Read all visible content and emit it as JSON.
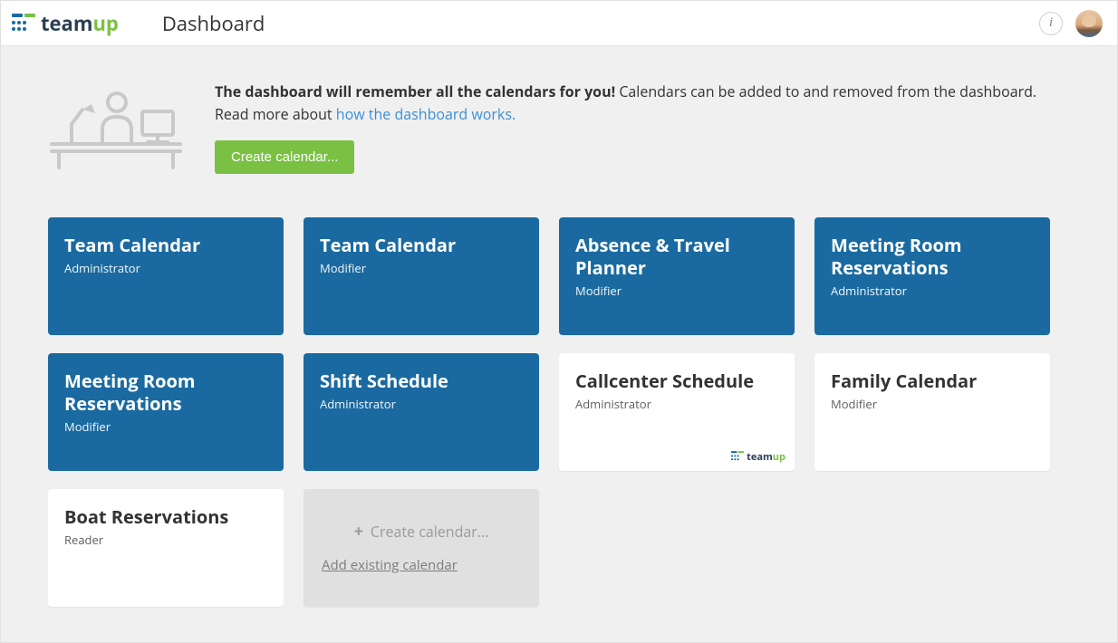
{
  "header": {
    "brand_team": "team",
    "brand_up": "up",
    "page_title": "Dashboard",
    "info_glyph": "i"
  },
  "intro": {
    "bold": "The dashboard will remember all the calendars for you!",
    "rest": " Calendars can be added to and removed from the dashboard. Read more about ",
    "link_text": "how the dashboard works.",
    "create_button": "Create calendar..."
  },
  "cards": [
    {
      "title": "Team Calendar",
      "role": "Administrator",
      "variant": "blue",
      "badge": false
    },
    {
      "title": "Team Calendar",
      "role": "Modifier",
      "variant": "blue",
      "badge": false
    },
    {
      "title": "Absence & Travel Planner",
      "role": "Modifier",
      "variant": "blue",
      "badge": false
    },
    {
      "title": "Meeting Room Reservations",
      "role": "Administrator",
      "variant": "blue",
      "badge": false
    },
    {
      "title": "Meeting Room Reservations",
      "role": "Modifier",
      "variant": "blue",
      "badge": false
    },
    {
      "title": "Shift Schedule",
      "role": "Administrator",
      "variant": "blue",
      "badge": false
    },
    {
      "title": "Callcenter Schedule",
      "role": "Administrator",
      "variant": "white",
      "badge": true
    },
    {
      "title": "Family Calendar",
      "role": "Modifier",
      "variant": "white",
      "badge": false
    },
    {
      "title": "Boat Reservations",
      "role": "Reader",
      "variant": "white",
      "badge": false
    }
  ],
  "placeholder": {
    "create_label": "Create calendar...",
    "add_existing_label": "Add existing calendar"
  },
  "mini_logo": {
    "team": "team",
    "up": "up"
  }
}
